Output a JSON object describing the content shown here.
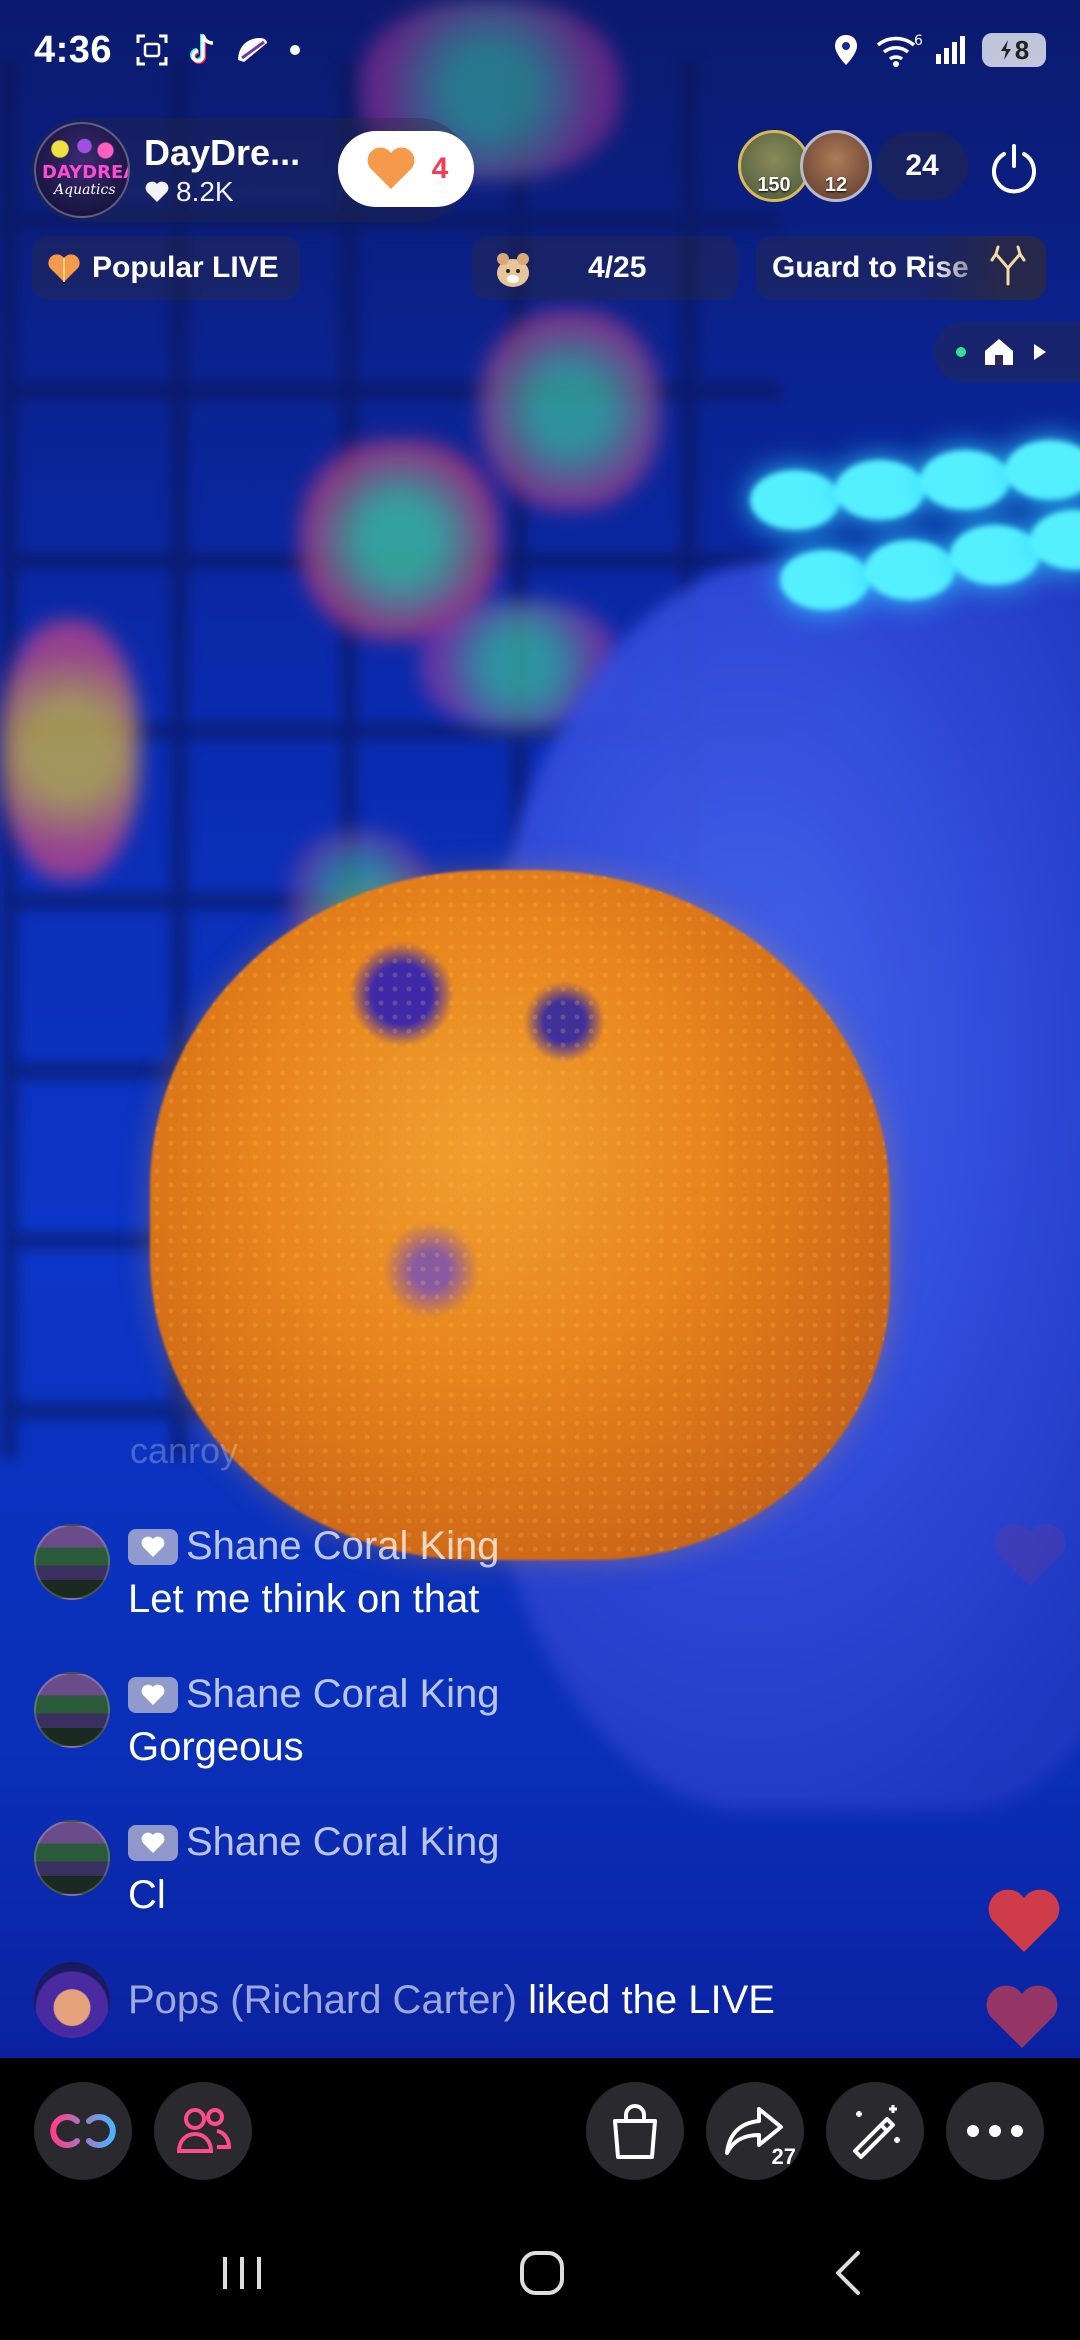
{
  "status_bar": {
    "time": "4:36",
    "battery_level": "8",
    "wifi_label": "6",
    "icons": [
      "screenshot-icon",
      "tiktok-icon",
      "taco-bell-icon",
      "location-icon",
      "wifi-icon",
      "signal-icon",
      "battery-icon"
    ]
  },
  "host": {
    "name": "DayDre...",
    "likes": "8.2K",
    "follow_count": "4"
  },
  "viewers": {
    "top1_badge": "150",
    "top2_badge": "12",
    "count": "24"
  },
  "pills": {
    "popular": "Popular LIVE",
    "rank_current": "4",
    "rank_total": "/25",
    "guard": "Guard to Rise"
  },
  "chat": {
    "faded_line": "canroy",
    "messages": [
      {
        "user": "Shane Coral King",
        "text": "Let me think on that"
      },
      {
        "user": "Shane Coral King",
        "text": "Gorgeous"
      },
      {
        "user": "Shane Coral King",
        "text": "Cl"
      }
    ],
    "join": {
      "user": "Pops (Richard Carter)",
      "action": "liked the LIVE"
    }
  },
  "toolbar": {
    "share_count": "27"
  },
  "colors": {
    "accent_red": "#ef3e55",
    "heart_orange": "#f59a4a",
    "toolbar_bg": "#000000",
    "button_bg": "#2a2a2e"
  }
}
